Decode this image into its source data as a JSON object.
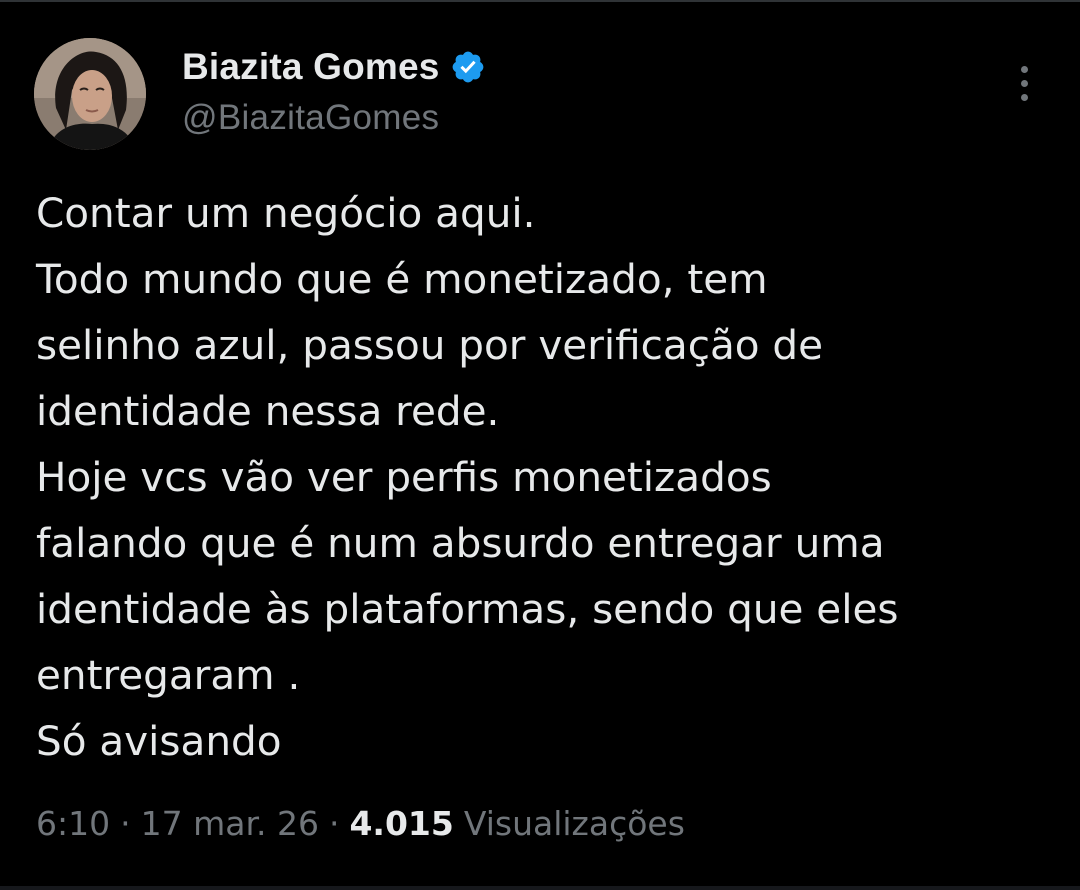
{
  "author": {
    "display_name": "Biazita Gomes",
    "handle": "@BiazitaGomes",
    "verified_icon": "verified-badge-icon",
    "verified_color": "#1d9bf0"
  },
  "tweet": {
    "text": "Contar um negócio aqui.\nTodo mundo que é monetizado, tem\nselinho azul, passou por verificação de\nidentidade nessa rede.\nHoje vcs vão ver perfis monetizados\nfalando que é num absurdo entregar uma\nidentidade às plataformas, sendo que eles\nentregaram .\nSó avisando"
  },
  "meta": {
    "time": "6:10",
    "separator": "·",
    "date": "17 mar. 26",
    "views_count": "4.015",
    "views_label": "Visualizações"
  },
  "actions": {
    "more_icon": "more-vertical-icon"
  },
  "colors": {
    "background": "#000000",
    "text_primary": "#e7e9ea",
    "text_secondary": "#71767b",
    "accent": "#1d9bf0"
  }
}
